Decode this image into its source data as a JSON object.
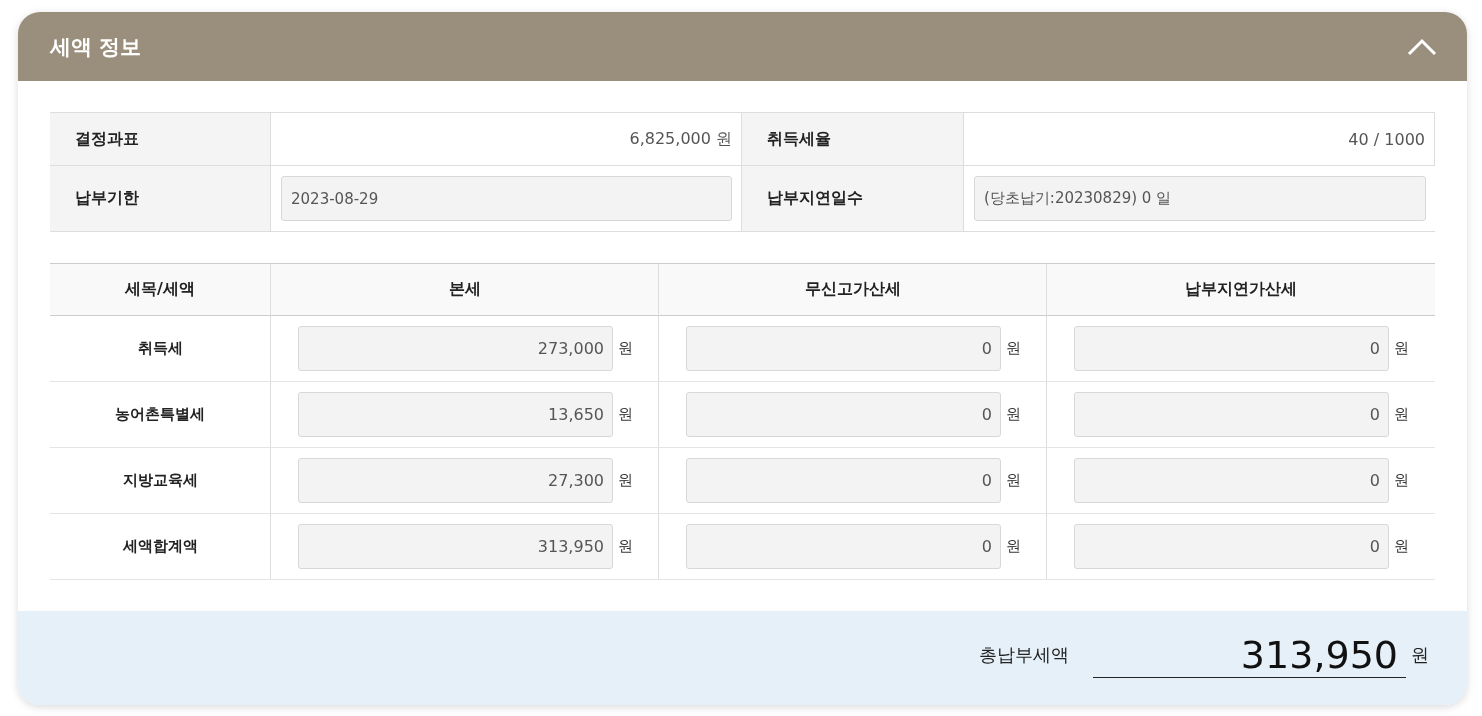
{
  "panel": {
    "title": "세액 정보",
    "expanded": true
  },
  "info": [
    {
      "label": "결정과표",
      "kind": "text",
      "value": "6,825,000 원"
    },
    {
      "label": "취득세율",
      "kind": "text",
      "value": "40 / 1000"
    },
    {
      "label": "납부기한",
      "kind": "field",
      "value": "2023-08-29"
    },
    {
      "label": "납부지연일수",
      "kind": "field",
      "value": "(당초납기:20230829) 0 일"
    }
  ],
  "tax_table": {
    "columns": [
      "세목/세액",
      "본세",
      "무신고가산세",
      "납부지연가산세"
    ],
    "rows": [
      {
        "name": "취득세",
        "cells": [
          {
            "value": "273,000",
            "unit": "원"
          },
          {
            "value": "0",
            "unit": "원"
          },
          {
            "value": "0",
            "unit": "원"
          }
        ]
      },
      {
        "name": "농어촌특별세",
        "cells": [
          {
            "value": "13,650",
            "unit": "원"
          },
          {
            "value": "0",
            "unit": "원"
          },
          {
            "value": "0",
            "unit": "원"
          }
        ]
      },
      {
        "name": "지방교육세",
        "cells": [
          {
            "value": "27,300",
            "unit": "원"
          },
          {
            "value": "0",
            "unit": "원"
          },
          {
            "value": "0",
            "unit": "원"
          }
        ]
      },
      {
        "name": "세액합계액",
        "cells": [
          {
            "value": "313,950",
            "unit": "원"
          },
          {
            "value": "0",
            "unit": "원"
          },
          {
            "value": "0",
            "unit": "원"
          }
        ]
      }
    ]
  },
  "total": {
    "label": "총납부세액",
    "value": "313,950",
    "unit": "원"
  }
}
